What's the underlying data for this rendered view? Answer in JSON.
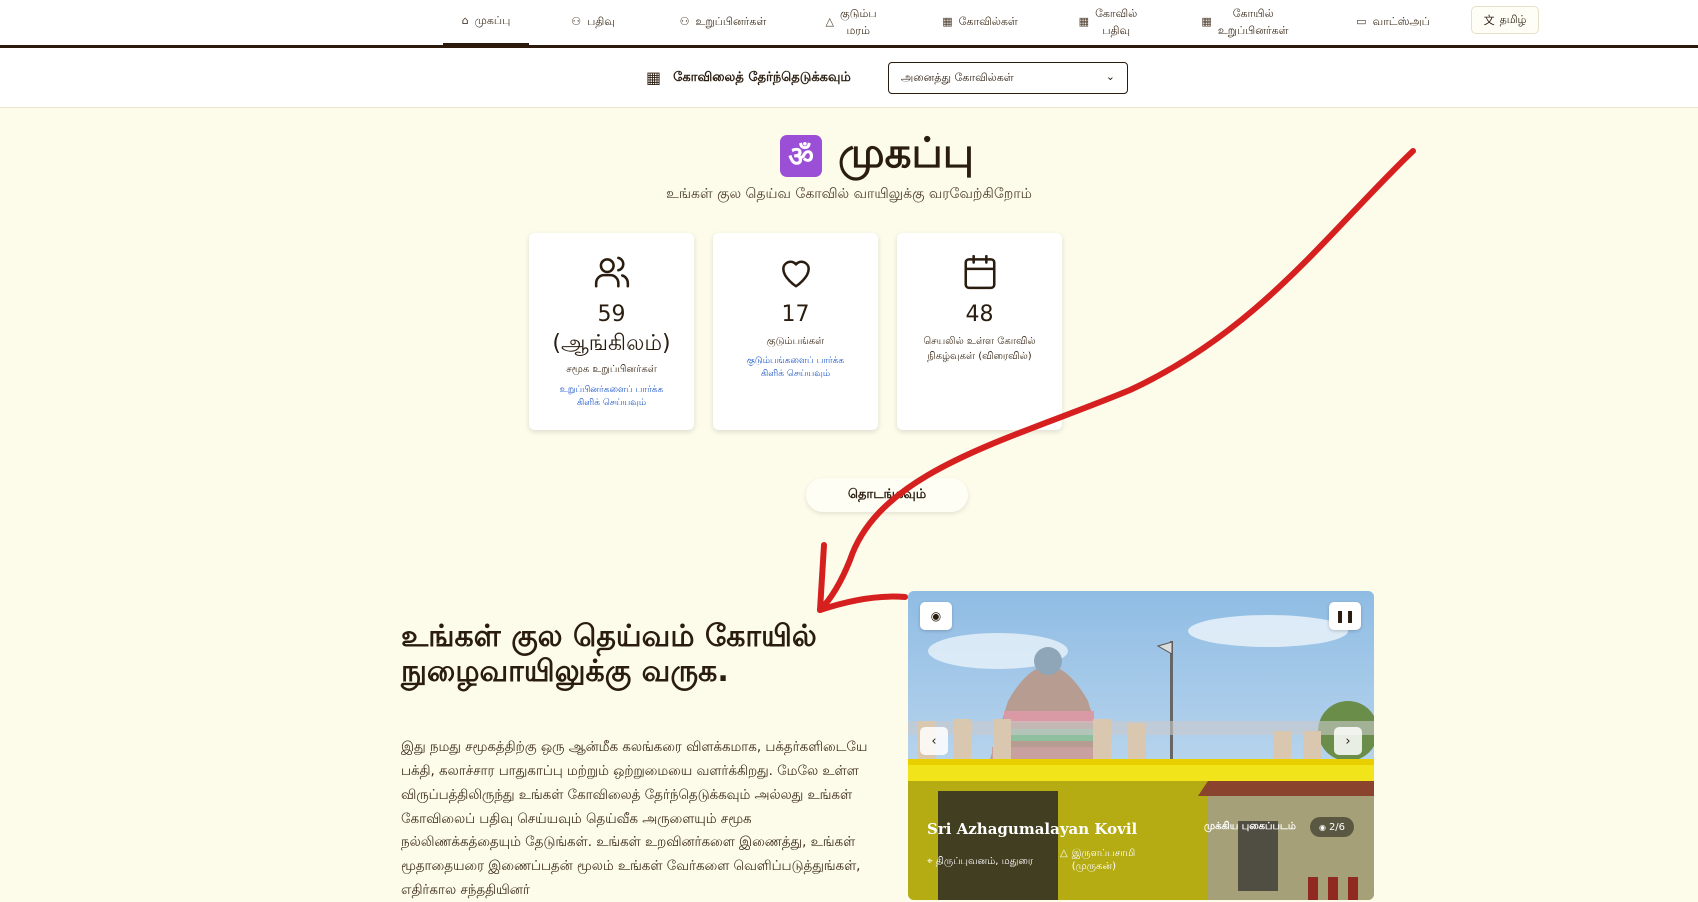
{
  "nav": {
    "items": [
      {
        "label": "முகப்பு",
        "icon": "home-icon"
      },
      {
        "label": "பதிவு",
        "icon": "user-plus-icon"
      },
      {
        "label": "உறுப்பினர்கள்",
        "icon": "users-icon"
      },
      {
        "label": "குடும்ப\nமரம்",
        "icon": "tree-icon"
      },
      {
        "label": "கோவில்கள்",
        "icon": "building-icon"
      },
      {
        "label": "கோவில்\nபதிவு",
        "icon": "building-icon"
      },
      {
        "label": "கோயில்\nஉறுப்பினர்கள்",
        "icon": "building-icon"
      },
      {
        "label": "வாட்ஸ்அப்",
        "icon": "chat-icon"
      }
    ],
    "language": "தமிழ்"
  },
  "temple_select": {
    "label": "கோவிலைத் தேர்ந்தெடுக்கவும்",
    "value": "அனைத்து கோவில்கள்"
  },
  "hero": {
    "title": "முகப்பு",
    "subtitle": "உங்கள் குல தெய்வ கோவில் வாயிலுக்கு வரவேற்கிறோம்"
  },
  "stats": [
    {
      "number": "59\n(ஆங்கிலம்)",
      "label": "சமூக உறுப்பினர்கள்",
      "link": "உறுப்பினர்களைப் பார்க்க கிளிக் செய்யவும்",
      "icon": "users-icon"
    },
    {
      "number": "17",
      "label": "குடும்பங்கள்",
      "link": "குடும்பங்களைப் பார்க்க கிளிக் செய்யவும்",
      "icon": "heart-icon"
    },
    {
      "number": "48",
      "label": "செயலில் உள்ள கோவில் நிகழ்வுகள் (விரைவில்)",
      "link": "",
      "icon": "calendar-icon"
    }
  ],
  "start_button": "தொடங்கவும்",
  "welcome": {
    "heading": "உங்கள் குல தெய்வம் கோயில் நுழைவாயிலுக்கு வருக.",
    "paragraph": "இது நமது சமூகத்திற்கு ஒரு ஆன்மீக கலங்கரை விளக்கமாக, பக்தர்களிடையே பக்தி, கலாச்சார பாதுகாப்பு மற்றும் ஒற்றுமையை வளர்க்கிறது. மேலே உள்ள விருப்பத்திலிருந்து உங்கள் கோவிலைத் தேர்ந்தெடுக்கவும் அல்லது உங்கள் கோவிலைப் பதிவு செய்யவும் தெய்வீக அருளையும் சமூக நல்லிணக்கத்தையும் தேடுங்கள். உங்கள் உறவினர்களை இணைத்து, உங்கள் மூதாதையரை இணைப்பதன் மூலம் உங்கள் வேர்களை வெளிப்படுத்துங்கள், எதிர்கால சந்ததியினர்"
  },
  "carousel": {
    "title": "Sri Azhagumalayan Kovil",
    "badge": "முக்கிய புகைப்படம்",
    "count": "2/6",
    "location": "திருப்புவனம், மதுரை",
    "deity": "இருளப்பசாமி\n(முருகன்)"
  },
  "colors": {
    "page_bg": "#fdfbea",
    "nav_border": "#2b1a0c",
    "link": "#1a55c9",
    "om_bg": "#9b4fd6",
    "annotation": "#d62020"
  }
}
